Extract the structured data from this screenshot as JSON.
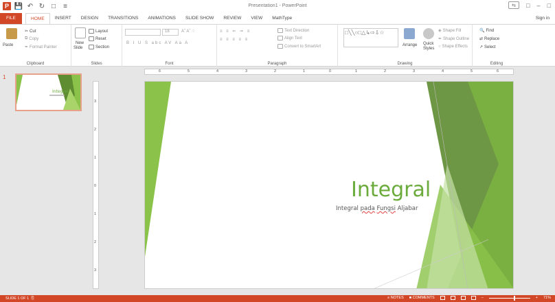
{
  "app": {
    "title": "Presentation1 - PowerPoint",
    "signin": "Sign in"
  },
  "tabs": [
    "FILE",
    "HOME",
    "INSERT",
    "DESIGN",
    "TRANSITIONS",
    "ANIMATIONS",
    "SLIDE SHOW",
    "REVIEW",
    "VIEW",
    "MathType"
  ],
  "active_tab": "HOME",
  "ribbon": {
    "clipboard": {
      "label": "Clipboard",
      "paste": "Paste",
      "cut": "Cut",
      "copy": "Copy",
      "format_painter": "Format Painter"
    },
    "slides": {
      "label": "Slides",
      "new_slide": "New",
      "new_slide2": "Slide",
      "layout": "Layout",
      "reset": "Reset",
      "section": "Section"
    },
    "font": {
      "label": "Font",
      "size": "18"
    },
    "paragraph": {
      "label": "Paragraph",
      "text_direction": "Text Direction",
      "align_text": "Align Text",
      "convert_smartart": "Convert to SmartArt"
    },
    "drawing": {
      "label": "Drawing",
      "arrange": "Arrange",
      "quick_styles": "Quick",
      "quick_styles2": "Styles",
      "shape_fill": "Shape Fill",
      "shape_outline": "Shape Outline",
      "shape_effects": "Shape Effects"
    },
    "editing": {
      "label": "Editing",
      "find": "Find",
      "replace": "Replace",
      "select": "Select"
    }
  },
  "thumbs": {
    "slide_number": "1",
    "thumb_title": "Integral"
  },
  "ruler": {
    "h": [
      "6",
      "5",
      "4",
      "3",
      "2",
      "1",
      "0",
      "1",
      "2",
      "3",
      "4",
      "5",
      "6"
    ],
    "v": [
      "3",
      "2",
      "1",
      "0",
      "1",
      "2",
      "3"
    ]
  },
  "slide": {
    "title": "Integral",
    "subtitle_pre": "Integral ",
    "subtitle_spell1": "pada",
    "subtitle_mid": " ",
    "subtitle_spell2": "Fungsi",
    "subtitle_post": " Aljabar"
  },
  "status": {
    "slide_of": "SLIDE 1 OF 1",
    "notes": "NOTES",
    "comments": "COMMENTS",
    "zoom": "71%"
  },
  "colors": {
    "accent": "#d24726",
    "green_light": "#9bcb4c",
    "green_dark": "#5e8c31",
    "title_green": "#6aab3c"
  }
}
